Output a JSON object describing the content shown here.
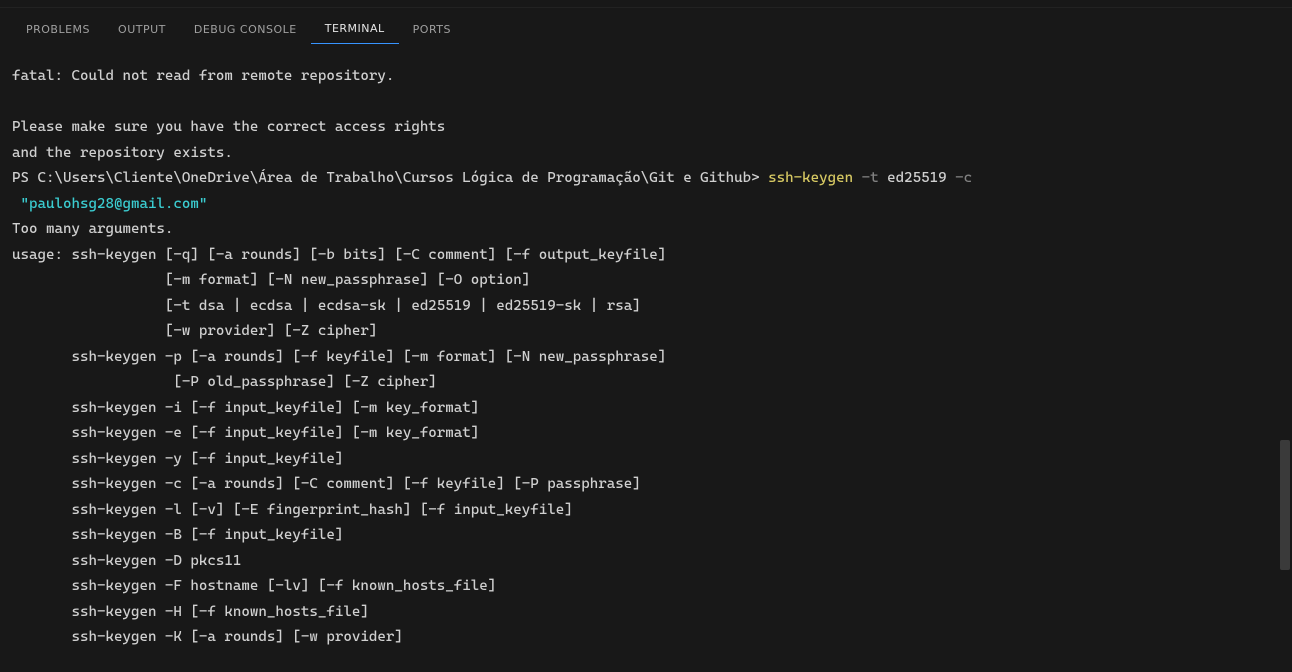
{
  "tabs": {
    "problems": "PROBLEMS",
    "output": "OUTPUT",
    "debug": "DEBUG CONSOLE",
    "terminal": "TERMINAL",
    "ports": "PORTS"
  },
  "term": {
    "l1": "fatal: Could not read from remote repository.",
    "blank": "",
    "l3": "Please make sure you have the correct access rights",
    "l4": "and the repository exists.",
    "ps": "PS C:\\Users\\Cliente\\OneDrive\\Área de Trabalho\\Cursos Lógica de Programação\\Git e Github> ",
    "cmd": "ssh-keygen",
    "space": " ",
    "flag_t": "-t",
    "arg_t": " ed25519 ",
    "flag_c": "-c",
    "cont": " \"paulohsg28@gmail.com\"",
    "l6": "Too many arguments.",
    "u1": "usage: ssh-keygen [-q] [-a rounds] [-b bits] [-C comment] [-f output_keyfile]",
    "u2": "                  [-m format] [-N new_passphrase] [-O option]",
    "u3": "                  [-t dsa | ecdsa | ecdsa-sk | ed25519 | ed25519-sk | rsa]",
    "u4": "                  [-w provider] [-Z cipher]",
    "u5": "       ssh-keygen -p [-a rounds] [-f keyfile] [-m format] [-N new_passphrase]",
    "u6": "                   [-P old_passphrase] [-Z cipher]",
    "u7": "       ssh-keygen -i [-f input_keyfile] [-m key_format]",
    "u8": "       ssh-keygen -e [-f input_keyfile] [-m key_format]",
    "u9": "       ssh-keygen -y [-f input_keyfile]",
    "u10": "       ssh-keygen -c [-a rounds] [-C comment] [-f keyfile] [-P passphrase]",
    "u11": "       ssh-keygen -l [-v] [-E fingerprint_hash] [-f input_keyfile]",
    "u12": "       ssh-keygen -B [-f input_keyfile]",
    "u13": "       ssh-keygen -D pkcs11",
    "u14": "       ssh-keygen -F hostname [-lv] [-f known_hosts_file]",
    "u15": "       ssh-keygen -H [-f known_hosts_file]",
    "u16": "       ssh-keygen -K [-a rounds] [-w provider]"
  }
}
